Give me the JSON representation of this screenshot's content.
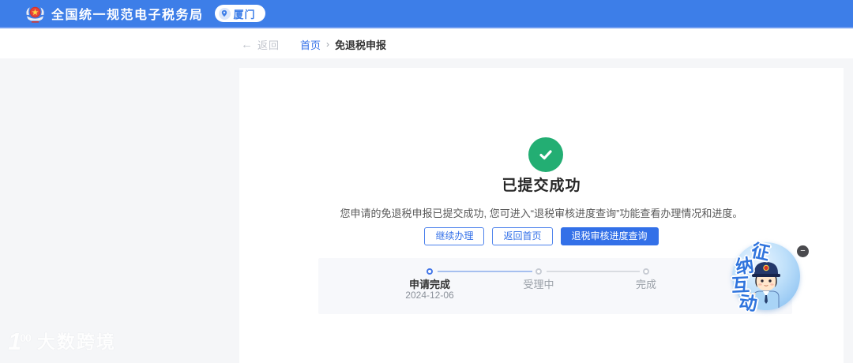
{
  "header": {
    "title": "全国统一规范电子税务局",
    "location_badge": "厦门"
  },
  "breadcrumb": {
    "back_icon": "←",
    "back": "返回",
    "home": "首页",
    "separator": "›",
    "current": "免退税申报"
  },
  "result": {
    "title": "已提交成功",
    "description": "您申请的免退税申报已提交成功, 您可进入“退税审核进度查询”功能查看办理情况和进度。"
  },
  "actions": {
    "continue": "继续办理",
    "back_home": "返回首页",
    "progress_query": "退税审核进度查询"
  },
  "steps": [
    {
      "label": "申请完成",
      "date": "2024-12-06",
      "state": "done"
    },
    {
      "label": "受理中",
      "date": "",
      "state": "pending"
    },
    {
      "label": "完成",
      "date": "",
      "state": "pending"
    }
  ],
  "mascot": {
    "chars": [
      "征",
      "纳",
      "互",
      "动"
    ],
    "minimize": "−"
  },
  "watermark": {
    "logo_main": "1",
    "logo_sup": "00",
    "text": "大数跨境"
  },
  "colors": {
    "header_bg": "#3D7EE8",
    "primary_blue": "#3370E8",
    "success_green": "#23AE73",
    "page_bg": "#F5F6F8"
  }
}
